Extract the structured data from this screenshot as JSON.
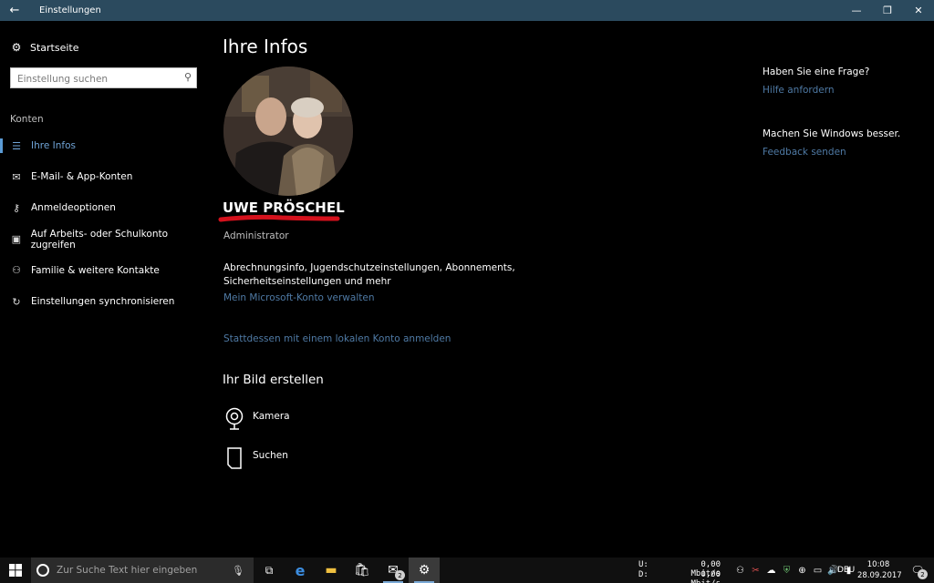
{
  "window": {
    "title": "Einstellungen",
    "back_icon": "←",
    "minimize_icon": "—",
    "restore_icon": "❐",
    "close_icon": "✕"
  },
  "sidebar": {
    "home_label": "Startseite",
    "search_placeholder": "Einstellung suchen",
    "section_label": "Konten",
    "items": [
      {
        "label": "Ihre Infos",
        "icon": "person-card-icon",
        "active": true
      },
      {
        "label": "E-Mail- & App-Konten",
        "icon": "mail-icon",
        "active": false
      },
      {
        "label": "Anmeldeoptionen",
        "icon": "key-icon",
        "active": false
      },
      {
        "label": "Auf Arbeits- oder Schulkonto zugreifen",
        "icon": "briefcase-icon",
        "active": false
      },
      {
        "label": "Familie & weitere Kontakte",
        "icon": "person-add-icon",
        "active": false
      },
      {
        "label": "Einstellungen synchronisieren",
        "icon": "sync-icon",
        "active": false
      }
    ]
  },
  "main": {
    "title": "Ihre Infos",
    "user_name": "UWE PRÖSCHEL",
    "role": "Administrator",
    "description": "Abrechnungsinfo, Jugendschutzeinstellungen, Abonnements, Sicherheitseinstellungen und mehr",
    "link_ms_account": "Mein Microsoft-Konto verwalten",
    "link_local": "Stattdessen mit einem lokalen Konto anmelden",
    "picture_heading": "Ihr Bild erstellen",
    "picture_options": [
      {
        "label": "Kamera",
        "icon": "camera-icon"
      },
      {
        "label": "Suchen",
        "icon": "file-icon"
      }
    ]
  },
  "help": {
    "question": "Haben Sie eine Frage?",
    "help_link": "Hilfe anfordern",
    "improve": "Machen Sie Windows besser.",
    "feedback_link": "Feedback senden"
  },
  "taskbar": {
    "search_placeholder": "Zur Suche Text hier eingeben",
    "mail_badge": "2",
    "net_up_label": "U:",
    "net_up_value": "0,00 Mbit/s",
    "net_down_label": "D:",
    "net_down_value": "0,00 Mbit/s",
    "language": "DEU",
    "time": "10:08",
    "date": "28.09.2017",
    "notification_badge": "2"
  },
  "colors": {
    "titlebar": "#2b4a5e",
    "accent": "#5b9bd5",
    "link": "#4f7aa5",
    "signature_line": "#d4111c"
  }
}
